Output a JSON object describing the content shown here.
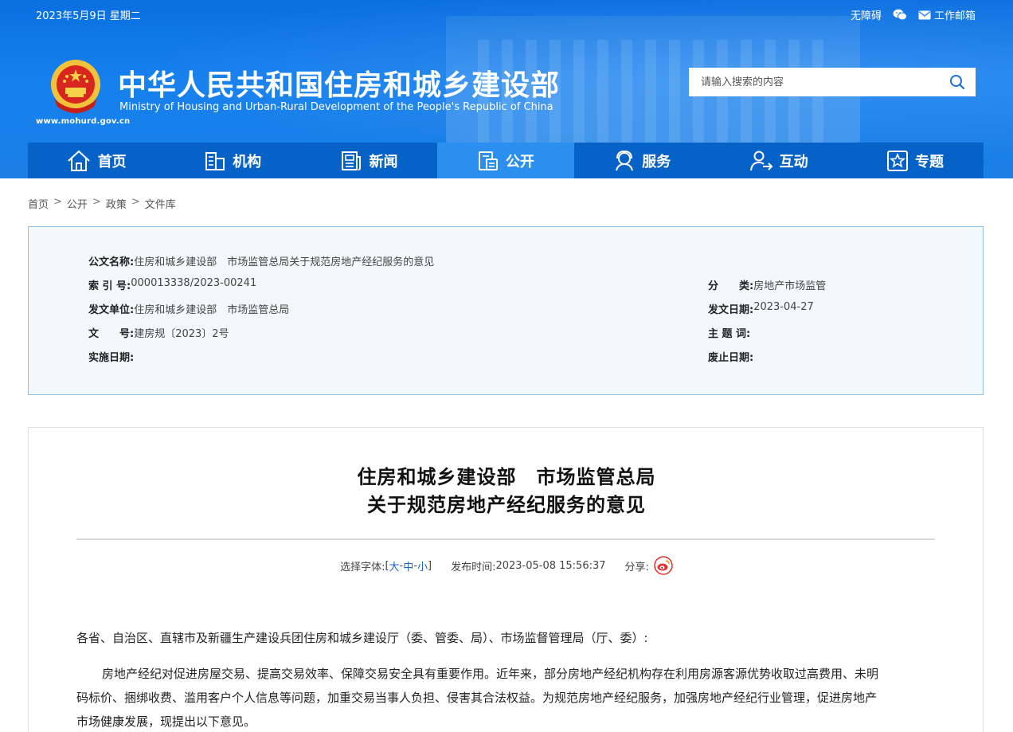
{
  "top": {
    "date": "2023年5月9日 星期二",
    "accessibility": "无障碍",
    "mail": "工作邮箱"
  },
  "brand": {
    "title_cn": "中华人民共和国住房和城乡建设部",
    "title_en": "Ministry of Housing and Urban-Rural Development of the People's Republic of China",
    "url": "www.mohurd.gov.cn"
  },
  "search": {
    "placeholder": "请输入搜索的内容"
  },
  "nav": [
    {
      "label": "首页",
      "icon": "home-icon"
    },
    {
      "label": "机构",
      "icon": "building-icon"
    },
    {
      "label": "新闻",
      "icon": "news-icon"
    },
    {
      "label": "公开",
      "icon": "document-icon",
      "active": true
    },
    {
      "label": "服务",
      "icon": "service-icon"
    },
    {
      "label": "互动",
      "icon": "interaction-icon"
    },
    {
      "label": "专题",
      "icon": "star-icon"
    }
  ],
  "breadcrumb": [
    "首页",
    "公开",
    "政策",
    "文件库"
  ],
  "info": {
    "name_key": "公文名称:",
    "name_val": "住房和城乡建设部　市场监管总局关于规范房地产经纪服务的意见",
    "index_key": "索 引 号:",
    "index_val": "000013338/2023-00241",
    "category_key": "分　　类:",
    "category_val": "房地产市场监管",
    "issuer_key": "发文单位:",
    "issuer_val": "住房和城乡建设部　市场监管总局",
    "issue_date_key": "发文日期:",
    "issue_date_val": "2023-04-27",
    "docno_key": "文　　号:",
    "docno_val": "建房规〔2023〕2号",
    "subject_key": "主 题 词:",
    "subject_val": "",
    "effective_key": "实施日期:",
    "effective_val": "",
    "abolish_key": "废止日期:",
    "abolish_val": ""
  },
  "article": {
    "title_line1": "住房和城乡建设部　市场监管总局",
    "title_line2": "关于规范房地产经纪服务的意见",
    "font_label": "选择字体:",
    "bracket_open": "[",
    "font_large": "大",
    "dash1": "-",
    "font_medium": "中",
    "dash2": "-",
    "font_small": "小",
    "bracket_close": "]",
    "publish_label": "发布时间:",
    "publish_time": "2023-05-08 15:56:37",
    "share_label": "分享:",
    "salutation": "各省、自治区、直辖市及新疆生产建设兵团住房和城乡建设厅（委、管委、局）、市场监督管理局（厅、委）:",
    "para1_l1": "房地产经纪对促进房屋交易、提高交易效率、保障交易安全具有重要作用。近年来，部分房地产经纪机构存在利用房源客源优势收取过高费用、未明",
    "para1_l2": "码标价、捆绑收费、滥用客户个人信息等问题，加重交易当事人负担、侵害其合法权益。为规范房地产经纪服务，加强房地产经纪行业管理，促进房地产",
    "para1_l3": "市场健康发展，现提出以下意见。"
  },
  "colors": {
    "header_blue": "#0a6fe0",
    "nav_blue": "#0762c8",
    "nav_active": "#2b8ff0",
    "info_bg": "#f3f8fd",
    "link_blue": "#1a62c5"
  }
}
